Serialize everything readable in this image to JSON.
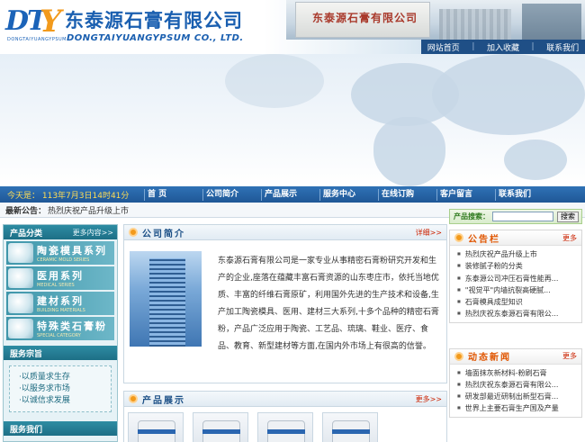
{
  "header": {
    "logo_letters": "DT",
    "logo_y": "Y",
    "logo_sub": "DONGTAIYUANGYPSUM",
    "company_cn": "东泰源石膏有限公司",
    "company_en": "DONGTAIYUANGYPSUM CO., LTD.",
    "building_sign": "东泰源石膏有限公司",
    "topnav": [
      "网站首页",
      "加入收藏",
      "联系我们"
    ]
  },
  "mainnav": {
    "date": "今天是： 113年7月3日14时41分",
    "items": [
      "首    页",
      "公司简介",
      "产品展示",
      "服务中心",
      "在线订购",
      "客户留言",
      "联系我们"
    ]
  },
  "announce": {
    "label": "最新公告：",
    "text": "热烈庆祝产品升级上市"
  },
  "left": {
    "category_title": "产品分类",
    "category_more": "更多内容>>",
    "categories": [
      {
        "cn": "陶瓷模具系列",
        "en": "CERAMIC MOLD SERIES"
      },
      {
        "cn": "医用系列",
        "en": "MEDICAL SERIES"
      },
      {
        "cn": "建材系列",
        "en": "BUILDING MATERIALS"
      },
      {
        "cn": "特殊类石膏粉",
        "en": "SPECIAL CATEGORY"
      }
    ],
    "service_title": "服务宗旨",
    "service_items": [
      "以质量求生存",
      "以服务求市场",
      "以诚信求发展"
    ],
    "contact_title": "服务我们"
  },
  "center": {
    "about_title": "公司简介",
    "about_more": "详细>>",
    "about_text": "东泰源石膏有限公司是一家专业从事精密石膏粉研究开发和生产的企业,座落在蕴藏丰富石膏资源的山东枣庄市，依托当地优质、丰富的纤维石膏原矿，利用国外先进的生产技术和设备,生产加工陶瓷模具、医用、建材三大系列,十多个品种的精密石膏粉，产品广泛应用于陶瓷、工艺品、琉璃、鞋业、医疗、食品、教育、新型建材等方面,在国内外市场上有很高的信誉。",
    "products_title": "产品展示",
    "products_more": "更多>>"
  },
  "right": {
    "search_label": "产品搜索：",
    "search_value": "",
    "search_button": "搜索",
    "notice_title": "公告栏",
    "notice_more": "更多",
    "notice_items": [
      "热烈庆祝产品升级上市",
      "装修腻子粉的分类",
      "东泰源公司冲压石膏性能再...",
      "\"视觉平\"内墙抗裂高硬腻...",
      "石膏模具成型知识",
      "热烈庆祝东泰源石膏有限公..."
    ],
    "news_title": "动态新闻",
    "news_more": "更多",
    "news_items": [
      "墙面抹灰新材料-粉刷石膏",
      "热烈庆祝东泰源石膏有限公...",
      "研发部最近研制出新型石膏...",
      "世界上主要石膏生产国及产量"
    ]
  },
  "colors": {
    "brand_blue": "#1a5fb0",
    "brand_orange": "#f29a1c",
    "nav_blue": "#1f5796",
    "teal": "#1d6f86"
  }
}
